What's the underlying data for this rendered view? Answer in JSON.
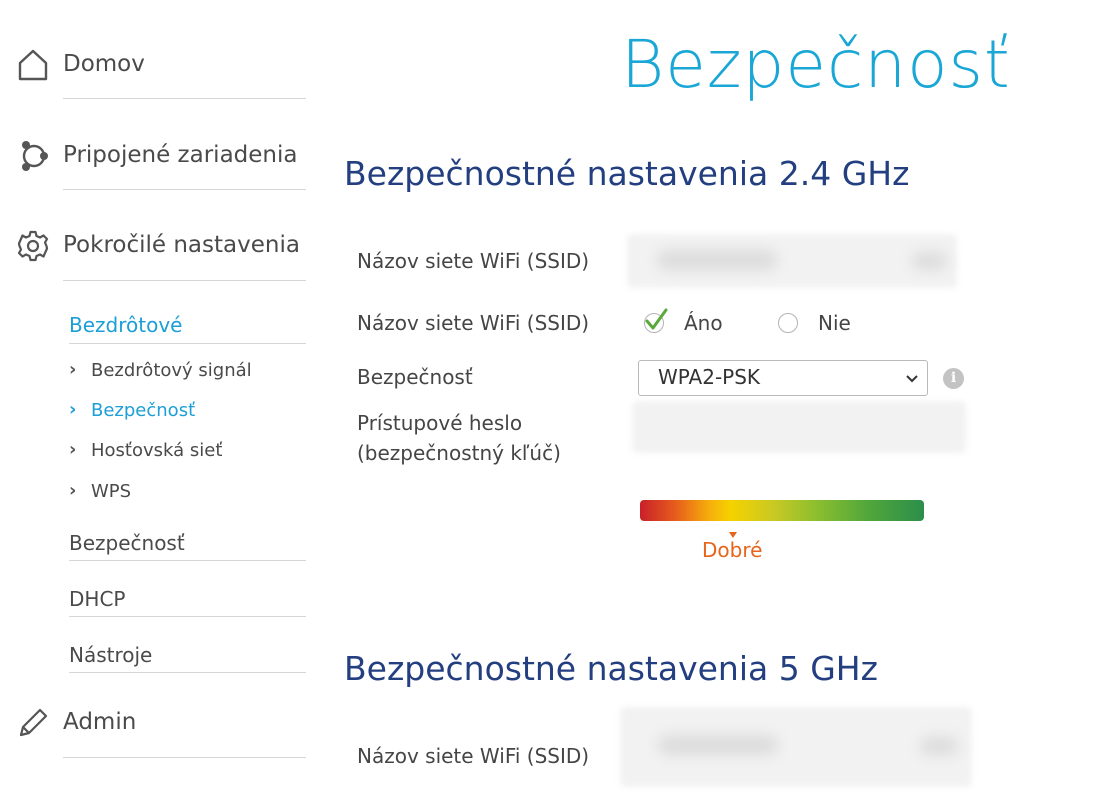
{
  "sidebar": {
    "home": {
      "label": "Domov",
      "icon": "home-icon"
    },
    "connected": {
      "label": "Pripojené zariadenia",
      "icon": "connected-devices-icon"
    },
    "advanced": {
      "label": "Pokročilé nastavenia",
      "icon": "gear-icon",
      "wireless": {
        "label": "Bezdrôtové",
        "items": [
          {
            "label": "Bezdrôtový signál",
            "active": false
          },
          {
            "label": "Bezpečnosť",
            "active": true
          },
          {
            "label": "Hosťovská sieť",
            "active": false
          },
          {
            "label": "WPS",
            "active": false
          }
        ]
      },
      "security": {
        "label": "Bezpečnosť"
      },
      "dhcp": {
        "label": "DHCP"
      },
      "tools": {
        "label": "Nástroje"
      }
    },
    "admin": {
      "label": "Admin",
      "icon": "pencil-icon"
    }
  },
  "page": {
    "title": "Bezpečnosť"
  },
  "section_24": {
    "title": "Bezpečnostné nastavenia 2.4 GHz",
    "ssid_label": "Názov siete WiFi (SSID)",
    "broadcast_label": "Názov siete WiFi (SSID)",
    "broadcast_yes": "Áno",
    "broadcast_no": "Nie",
    "broadcast_selected": "Áno",
    "security_label": "Bezpečnosť",
    "security_value": "WPA2-PSK",
    "info_icon": "info-icon",
    "password_label_line1": "Prístupové heslo",
    "password_label_line2": "(bezpečnostný kľúč)",
    "strength_text": "Dobré",
    "strength_level": 0.33
  },
  "section_5": {
    "title": "Bezpečnostné nastavenia 5 GHz",
    "ssid_label": "Názov siete WiFi (SSID)"
  },
  "colors": {
    "accent": "#1c9ed6",
    "title": "#1aa7d6",
    "section_title": "#233f80",
    "strength": "#e8641c"
  }
}
